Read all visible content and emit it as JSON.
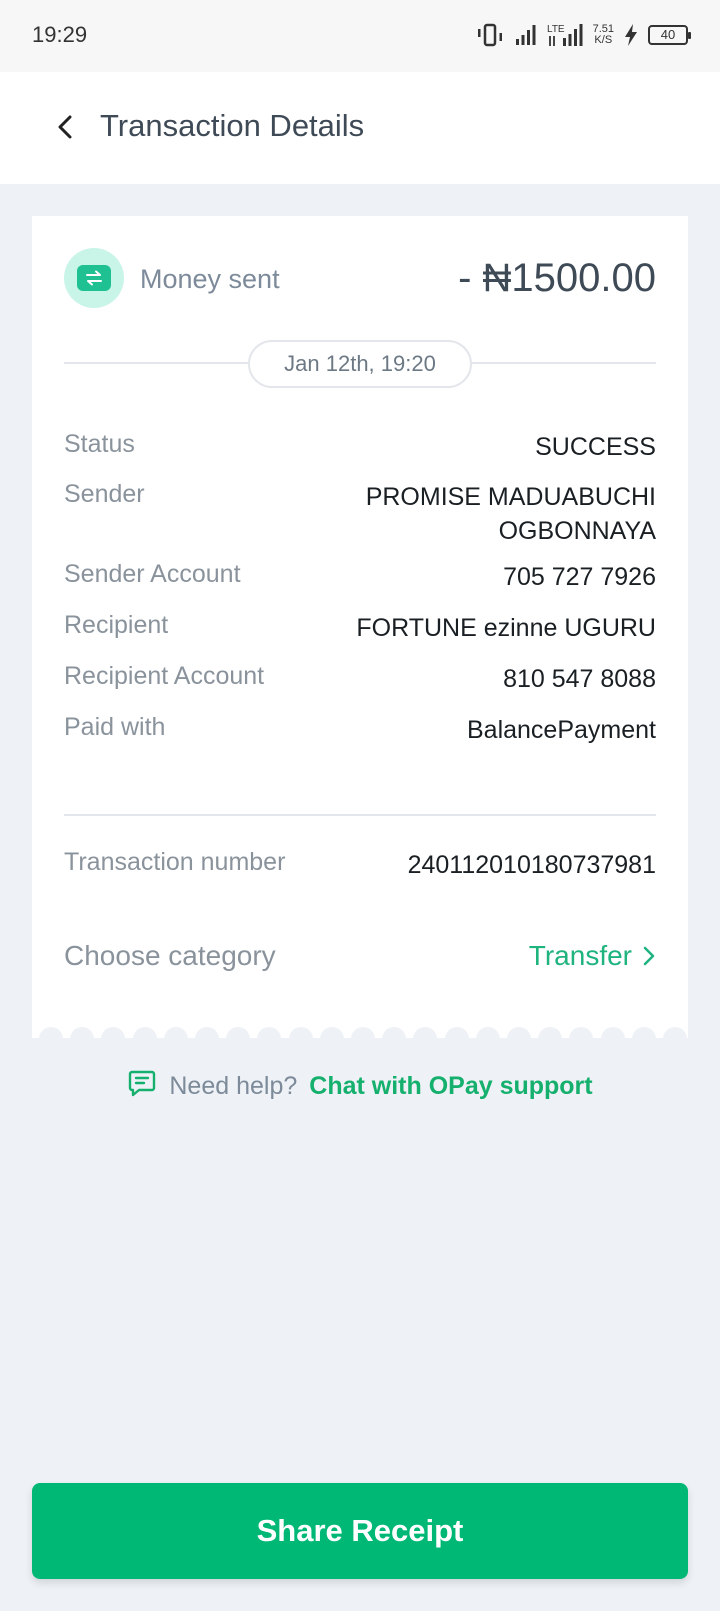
{
  "status_bar": {
    "time": "19:29",
    "net_speed_value": "7.51",
    "net_speed_unit": "K/S",
    "battery": "40",
    "icons": [
      "vibrate-icon",
      "signal-icon",
      "lte-signal-icon",
      "charging-icon",
      "battery-icon"
    ]
  },
  "header": {
    "title": "Transaction Details",
    "back_icon": "chevron-left-icon"
  },
  "transaction": {
    "type_label": "Money sent",
    "type_icon": "transfer-arrows-icon",
    "amount": "- ₦1500.00",
    "date": "Jan 12th, 19:20",
    "details": [
      {
        "label": "Status",
        "value": "SUCCESS"
      },
      {
        "label": "Sender",
        "value_line1": "PROMISE MADUABUCHI",
        "value_line2": "OGBONNAYA"
      },
      {
        "label": "Sender Account",
        "value": "705 727 7926"
      },
      {
        "label": "Recipient",
        "value": "FORTUNE ezinne UGURU"
      },
      {
        "label": "Recipient Account",
        "value": "810 547 8088"
      },
      {
        "label": "Paid with",
        "value": "BalancePayment"
      }
    ],
    "transaction_number_label": "Transaction number",
    "transaction_number": "240112010180737981",
    "category_label": "Choose category",
    "category_value": "Transfer"
  },
  "help": {
    "prefix": "Need help?",
    "link": "Chat with OPay support",
    "icon": "chat-icon"
  },
  "share_button": "Share Receipt",
  "colors": {
    "brand_green": "#00b876",
    "link_green": "#15b06e",
    "background": "#eef2f6",
    "text_dark": "#1a1f24",
    "text_muted": "#8a939c"
  }
}
